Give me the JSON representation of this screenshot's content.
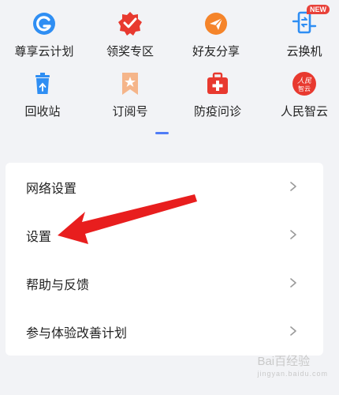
{
  "grid": {
    "row1": [
      {
        "label": "尊享云计划",
        "icon": "cloud-refresh-icon"
      },
      {
        "label": "领奖专区",
        "icon": "award-badge-icon"
      },
      {
        "label": "好友分享",
        "icon": "paper-plane-icon"
      },
      {
        "label": "云换机",
        "icon": "phone-transfer-icon",
        "badge": "NEW"
      }
    ],
    "row2": [
      {
        "label": "回收站",
        "icon": "trash-bin-icon"
      },
      {
        "label": "订阅号",
        "icon": "bookmark-star-icon"
      },
      {
        "label": "防疫问诊",
        "icon": "medical-kit-icon"
      },
      {
        "label": "人民智云",
        "icon": "renmin-logo-icon",
        "logo_text": "人民智云"
      }
    ]
  },
  "settings": {
    "items": [
      {
        "label": "网络设置"
      },
      {
        "label": "设置"
      },
      {
        "label": "帮助与反馈"
      },
      {
        "label": "参与体验改善计划"
      }
    ]
  },
  "watermark": {
    "text": "Bai百经验",
    "sub": "jingyan.baidu.com"
  },
  "colors": {
    "accent": "#4f7cf6",
    "background": "#f2f3f6",
    "arrow": "#e81e1e",
    "blue": "#2f8ef3",
    "red": "#e8392f",
    "orange": "#f5842a",
    "peach": "#f5b58a"
  }
}
